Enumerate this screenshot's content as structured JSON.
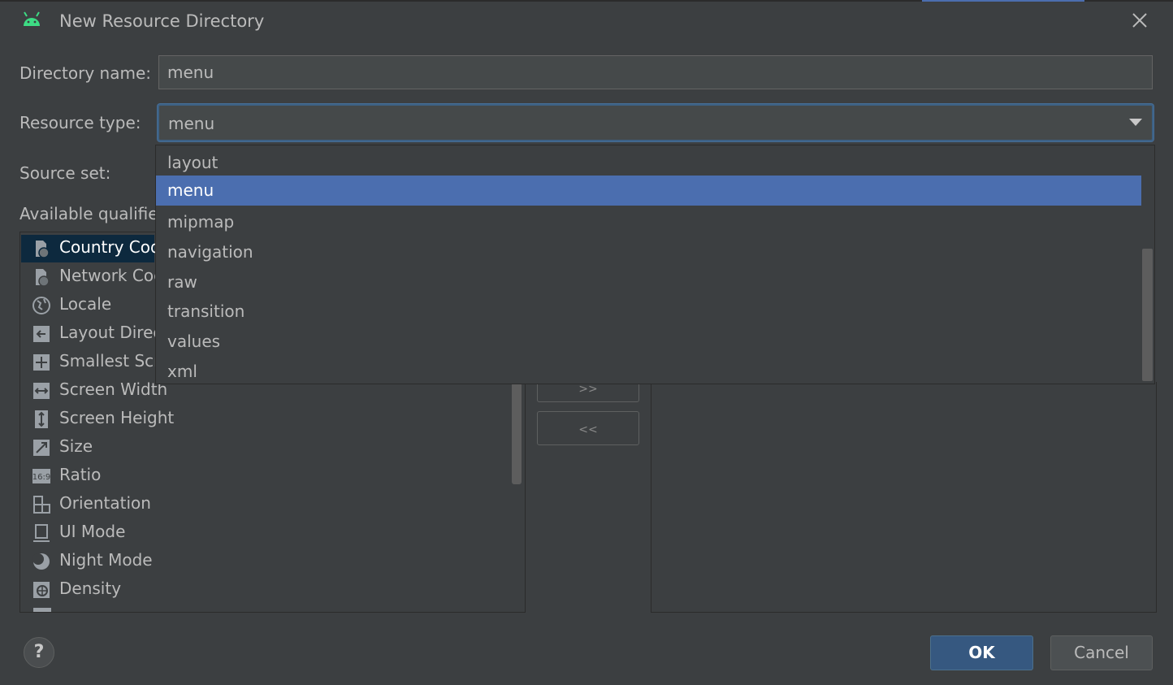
{
  "dialog": {
    "title": "New Resource Directory",
    "close_label": "×"
  },
  "form": {
    "directory_name_label": "Directory name:",
    "directory_name_value": "menu",
    "resource_type_label": "Resource type:",
    "resource_type_value": "menu",
    "source_set_label": "Source set:",
    "available_qualifiers_label": "Available qualifier"
  },
  "dropdown": {
    "options": [
      "layout",
      "menu",
      "mipmap",
      "navigation",
      "raw",
      "transition",
      "values",
      "xml"
    ],
    "selected": "menu"
  },
  "qualifiers": [
    {
      "label": "Country Cod",
      "icon": "country-code-icon",
      "selected": true
    },
    {
      "label": "Network Coc",
      "icon": "network-code-icon",
      "selected": false
    },
    {
      "label": "Locale",
      "icon": "globe-icon",
      "selected": false
    },
    {
      "label": "Layout Direc",
      "icon": "layout-direction-icon",
      "selected": false
    },
    {
      "label": "Smallest Scre",
      "icon": "smallest-screen-icon",
      "selected": false
    },
    {
      "label": "Screen Width",
      "icon": "screen-width-icon",
      "selected": false
    },
    {
      "label": "Screen Height",
      "icon": "screen-height-icon",
      "selected": false
    },
    {
      "label": "Size",
      "icon": "size-icon",
      "selected": false
    },
    {
      "label": "Ratio",
      "icon": "ratio-icon",
      "selected": false
    },
    {
      "label": "Orientation",
      "icon": "orientation-icon",
      "selected": false
    },
    {
      "label": "UI Mode",
      "icon": "ui-mode-icon",
      "selected": false
    },
    {
      "label": "Night Mode",
      "icon": "night-mode-icon",
      "selected": false
    },
    {
      "label": "Density",
      "icon": "density-icon",
      "selected": false
    }
  ],
  "buttons": {
    "add": ">>",
    "remove": "<<",
    "help": "?",
    "ok": "OK",
    "cancel": "Cancel"
  },
  "colors": {
    "background": "#3c3f41",
    "selection": "#4b6eaf",
    "ok_button": "#365880",
    "android_green": "#3ddc84"
  }
}
